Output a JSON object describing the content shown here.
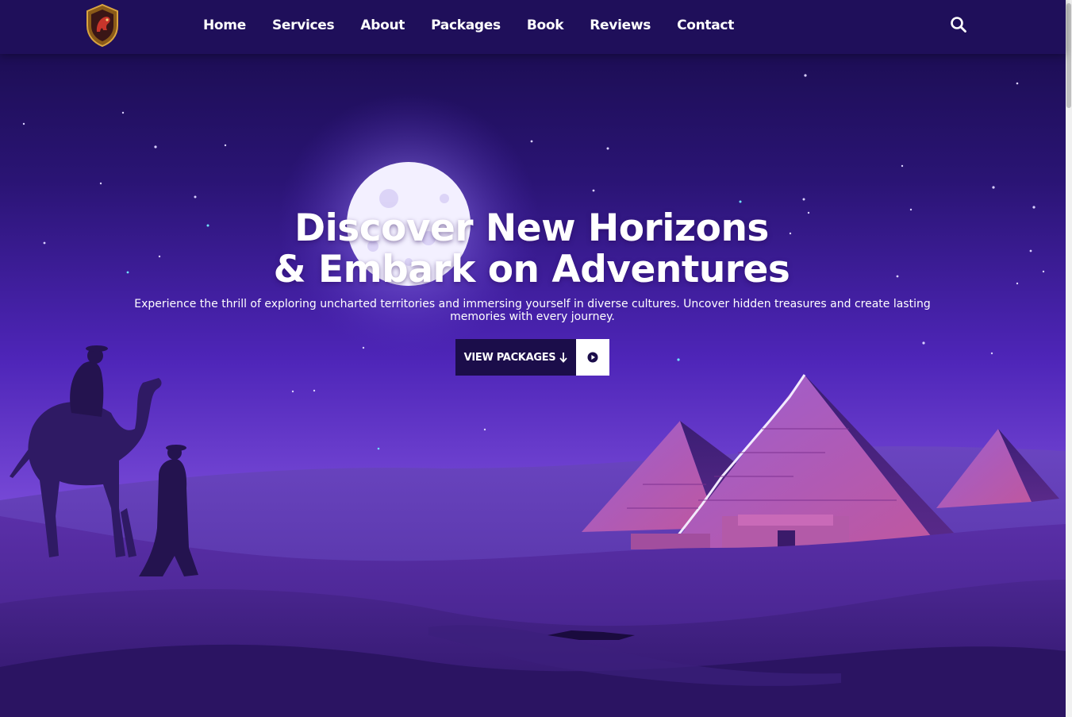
{
  "nav": {
    "logo": "shield-horse-logo",
    "links": [
      "Home",
      "Services",
      "About",
      "Packages",
      "Book",
      "Reviews",
      "Contact"
    ],
    "search_icon": "search-icon"
  },
  "hero": {
    "title_line1": "Discover New Horizons",
    "title_line2": "& Embark on Adventures",
    "subtitle": "Experience the thrill of exploring uncharted territories and immersing yourself in diverse cultures. Uncover hidden treasures and create lasting memories with every journey.",
    "cta_label": "VIEW PACKAGES",
    "cta_icon": "arrow-down-icon",
    "play_icon": "play-circle-icon"
  },
  "colors": {
    "nav_bg": "#1f0f5a",
    "sky_top": "#1c0e52",
    "sky_bottom": "#7a4ad8",
    "button_dark": "#1b0d4a",
    "pyramid": "#8a4fc9"
  }
}
